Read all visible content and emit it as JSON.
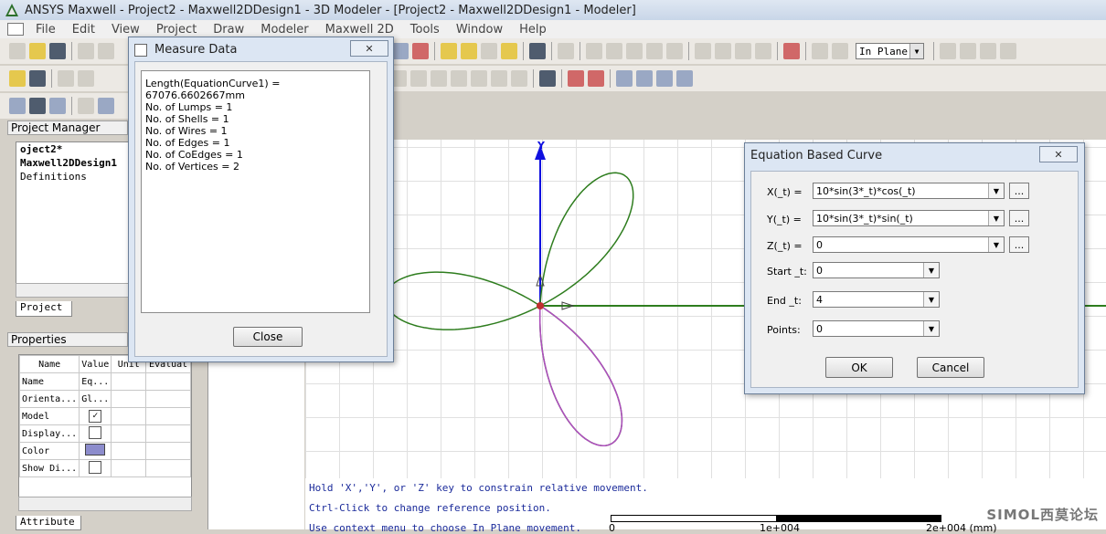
{
  "window": {
    "title": "ANSYS Maxwell - Project2 - Maxwell2DDesign1 - 3D Modeler - [Project2 - Maxwell2DDesign1 - Modeler]"
  },
  "menu": [
    "File",
    "Edit",
    "View",
    "Project",
    "Draw",
    "Modeler",
    "Maxwell 2D",
    "Tools",
    "Window",
    "Help"
  ],
  "toolbar": {
    "movement_mode": "In Plane"
  },
  "project_manager": {
    "header": "Project Manager",
    "tree": [
      "oject2*",
      "Maxwell2DDesign1",
      "Definitions"
    ],
    "tab": "Project"
  },
  "properties": {
    "header": "Properties",
    "columns": [
      "Name",
      "Value",
      "Unit",
      "Evaluat"
    ],
    "rows": [
      {
        "name": "Name",
        "value": "Eq..."
      },
      {
        "name": "Orienta...",
        "value": "Gl..."
      },
      {
        "name": "Model",
        "value": "✓"
      },
      {
        "name": "Display...",
        "value": ""
      },
      {
        "name": "Color",
        "value": ""
      },
      {
        "name": "Show Di...",
        "value": ""
      }
    ],
    "tab": "Attribute",
    "color_swatch": "#8c8ccc"
  },
  "measure_dialog": {
    "title": "Measure Data",
    "lines": [
      "Length(EquationCurve1) = 67076.6602667mm",
      "No. of Lumps = 1",
      "No. of Shells = 1",
      "No. of Wires = 1",
      "No. of Edges = 1",
      "No. of CoEdges = 1",
      "No. of Vertices = 2"
    ],
    "close_label": "Close"
  },
  "equation_dialog": {
    "title": "Equation Based Curve",
    "x_label": "X(_t) =",
    "x_value": "10*sin(3*_t)*cos(_t)",
    "y_label": "Y(_t) =",
    "y_value": "10*sin(3*_t)*sin(_t)",
    "z_label": "Z(_t) =",
    "z_value": "0",
    "start_label": "Start _t:",
    "start_value": "0",
    "end_label": "End _t:",
    "end_value": "4",
    "points_label": "Points:",
    "points_value": "0",
    "ellipsis": "...",
    "ok_label": "OK",
    "cancel_label": "Cancel"
  },
  "canvas": {
    "axis_y_label": "Y",
    "messages": [
      "Hold 'X','Y', or 'Z' key to constrain relative movement.",
      "Ctrl-Click to change reference position.",
      "Use context menu to choose In Plane movement."
    ],
    "ruler_labels": [
      "0",
      "1e+004",
      "2e+004 (mm)"
    ],
    "curve_color": "#2e7d1e",
    "highlight_color": "#b04cc0",
    "axis_color": "#1010e0"
  },
  "watermark": "SIMOL西莫论坛"
}
